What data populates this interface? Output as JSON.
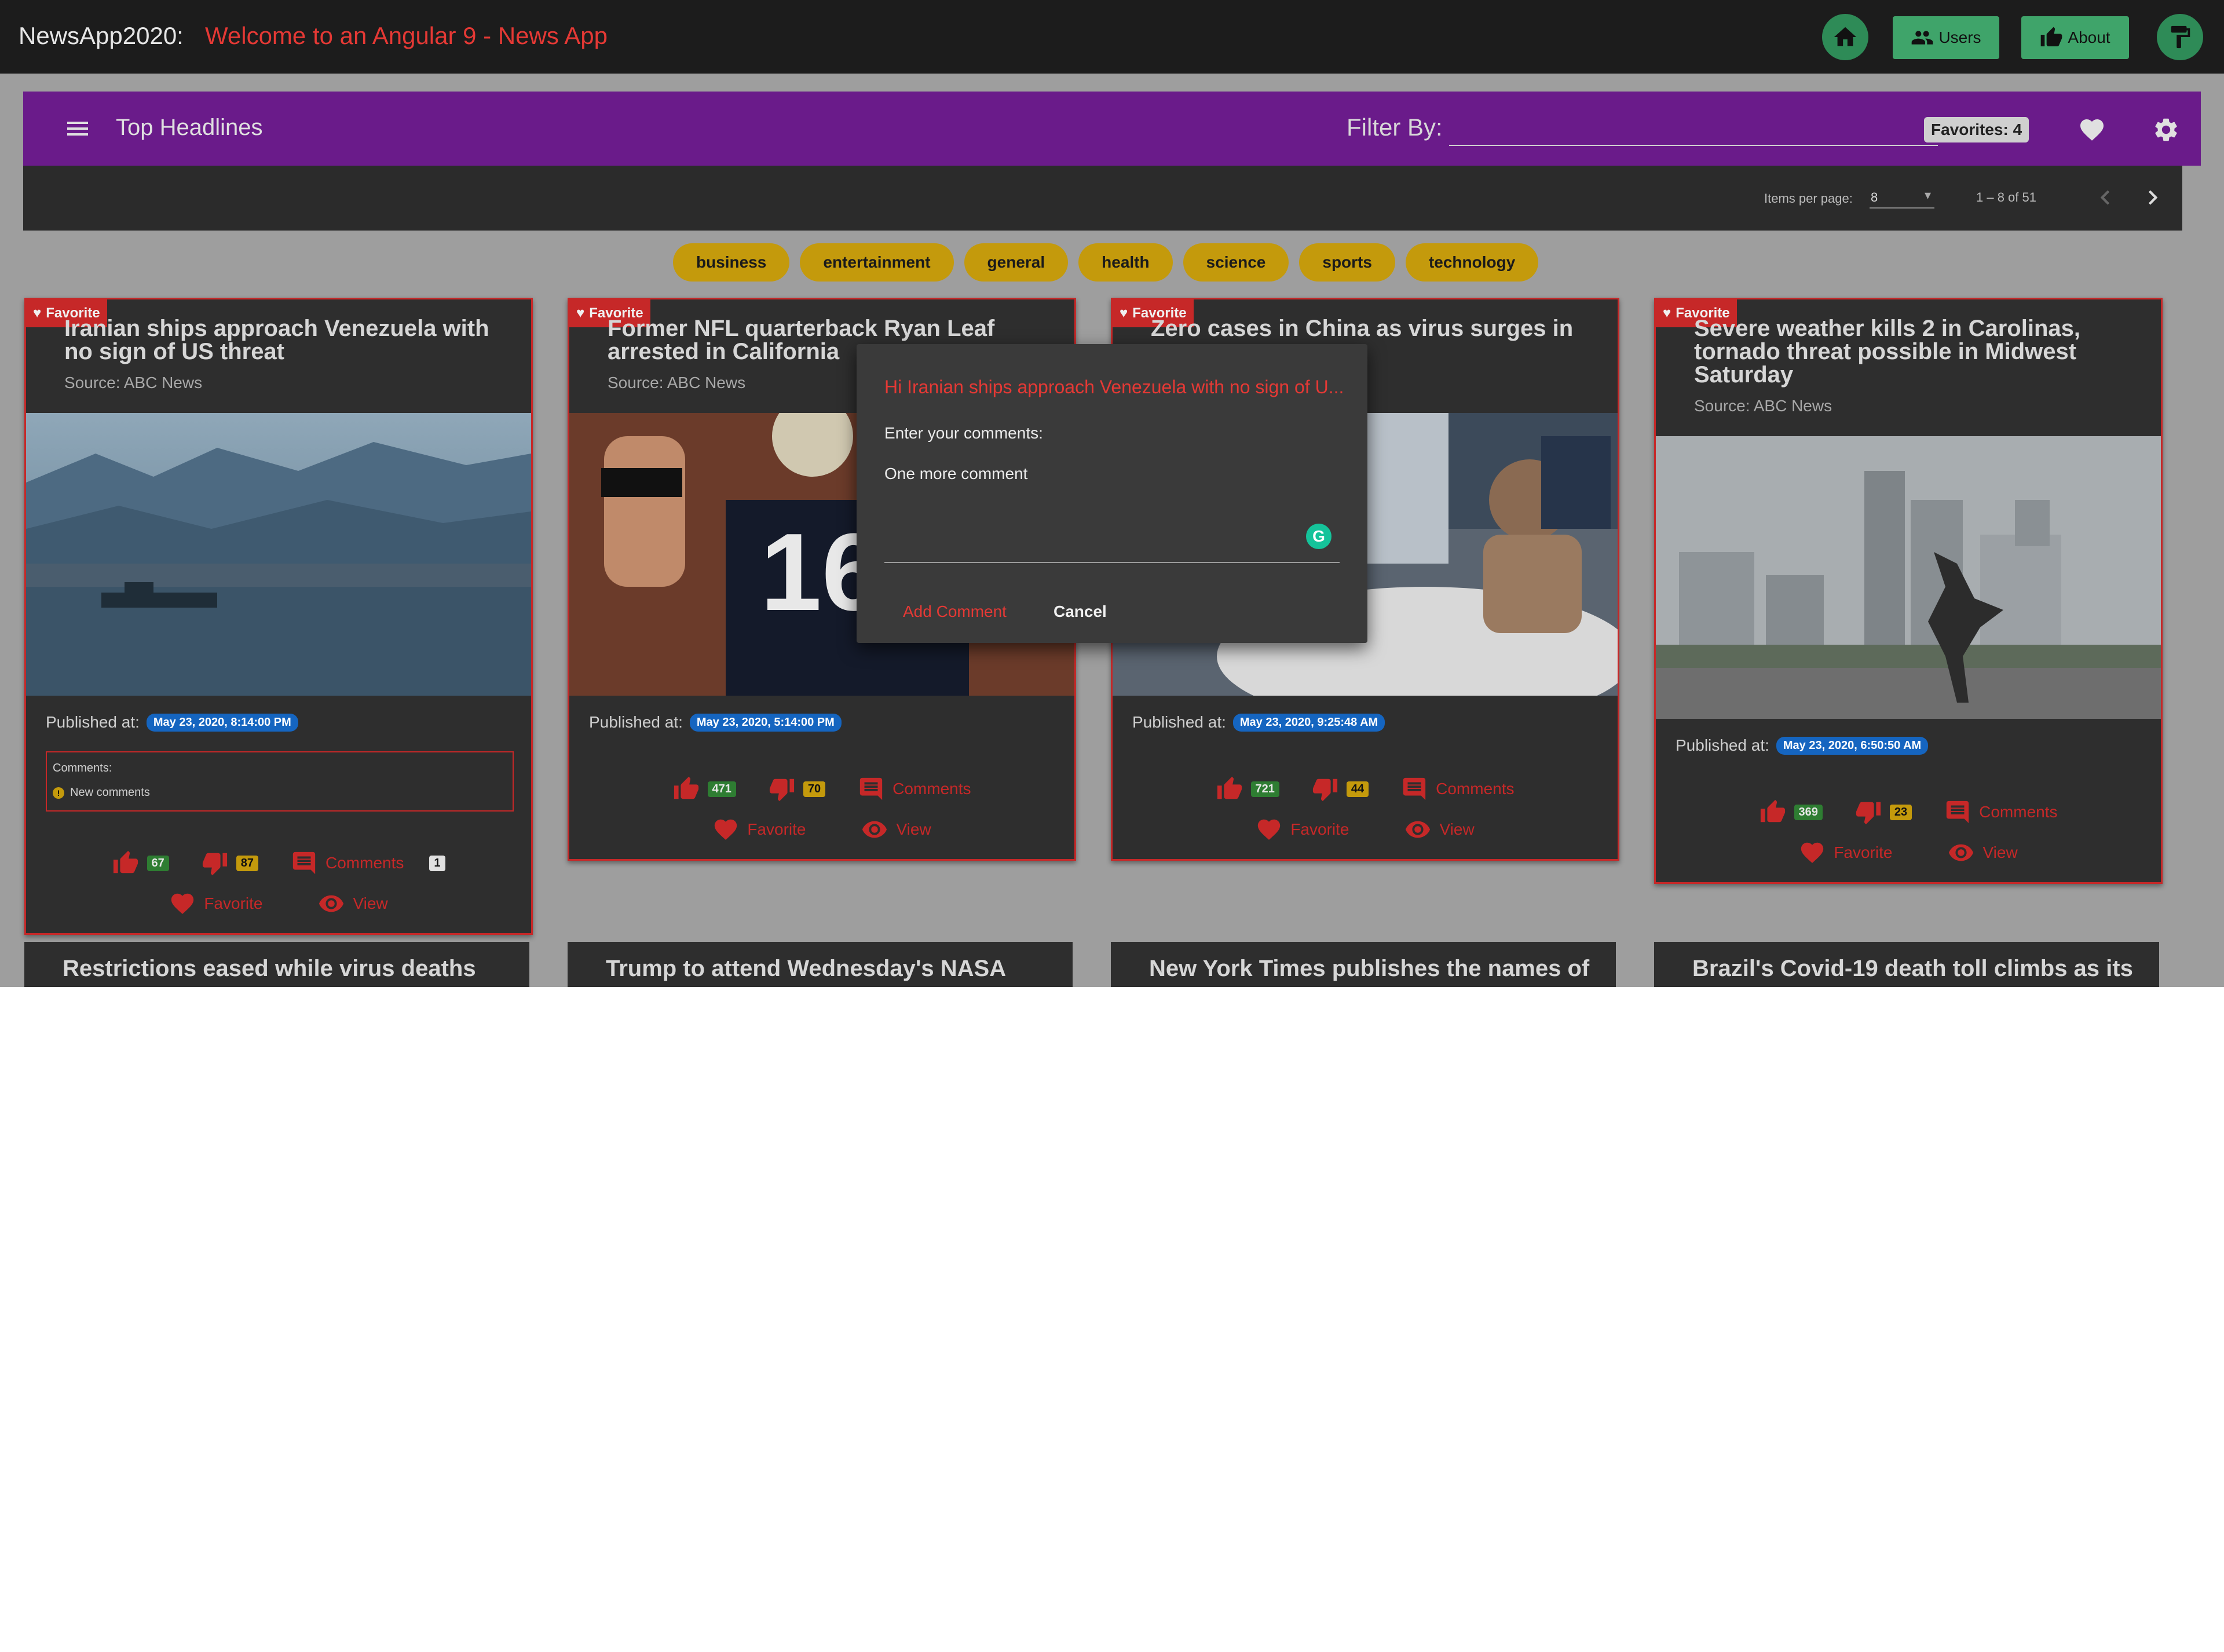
{
  "appbar": {
    "brand": "NewsApp2020:",
    "welcome": "Welcome to an Angular 9 - News App",
    "users_label": "Users",
    "about_label": "About",
    "accent": "#2e8b57"
  },
  "toolbar": {
    "title": "Top Headlines",
    "filter_label": "Filter By:",
    "filter_value": "",
    "favorites_badge": "Favorites: 4",
    "background": "#6a1b8a"
  },
  "paginator": {
    "items_per_page_label": "Items per page:",
    "items_per_page_value": "8",
    "range_label": "1 – 8 of 51"
  },
  "categories": [
    "business",
    "entertainment",
    "general",
    "health",
    "science",
    "sports",
    "technology"
  ],
  "cards": [
    {
      "favorite_label": "Favorite",
      "title": "Iranian ships approach Venezuela with no sign of US threat",
      "source": "Source: ABC News",
      "published_label": "Published at:",
      "published_date": "May 23, 2020, 8:14:00 PM",
      "comments_label": "Comments:",
      "comment_item": "New comments",
      "likes": "67",
      "dislikes": "87",
      "comments_text": "Comments",
      "comments_count": "1",
      "favorite_text": "Favorite",
      "view_text": "View"
    },
    {
      "favorite_label": "Favorite",
      "title": "Former NFL quarterback Ryan Leaf arrested in California",
      "source": "Source: ABC News",
      "published_label": "Published at:",
      "published_date": "May 23, 2020, 5:14:00 PM",
      "likes": "471",
      "dislikes": "70",
      "comments_text": "Comments",
      "favorite_text": "Favorite",
      "view_text": "View"
    },
    {
      "favorite_label": "Favorite",
      "title": "Zero cases in China as virus surges in",
      "source": "",
      "published_label": "Published at:",
      "published_date": "May 23, 2020, 9:25:48 AM",
      "likes": "721",
      "dislikes": "44",
      "comments_text": "Comments",
      "favorite_text": "Favorite",
      "view_text": "View"
    },
    {
      "favorite_label": "Favorite",
      "title": "Severe weather kills 2 in Carolinas, tornado threat possible in Midwest Saturday",
      "source": "Source: ABC News",
      "published_label": "Published at:",
      "published_date": "May 23, 2020, 6:50:50 AM",
      "likes": "369",
      "dislikes": "23",
      "comments_text": "Comments",
      "favorite_text": "Favorite",
      "view_text": "View"
    }
  ],
  "row2_titles": [
    "Restrictions eased while virus deaths",
    "Trump to attend Wednesday's NASA",
    "New York Times publishes the names of",
    "Brazil's Covid-19 death toll climbs as its"
  ],
  "dialog": {
    "title": "Hi Iranian ships approach Venezuela with no sign of U...",
    "prompt": "Enter your comments:",
    "text": "One more comment",
    "add_label": "Add Comment",
    "cancel_label": "Cancel",
    "grammarly_letter": "G"
  }
}
